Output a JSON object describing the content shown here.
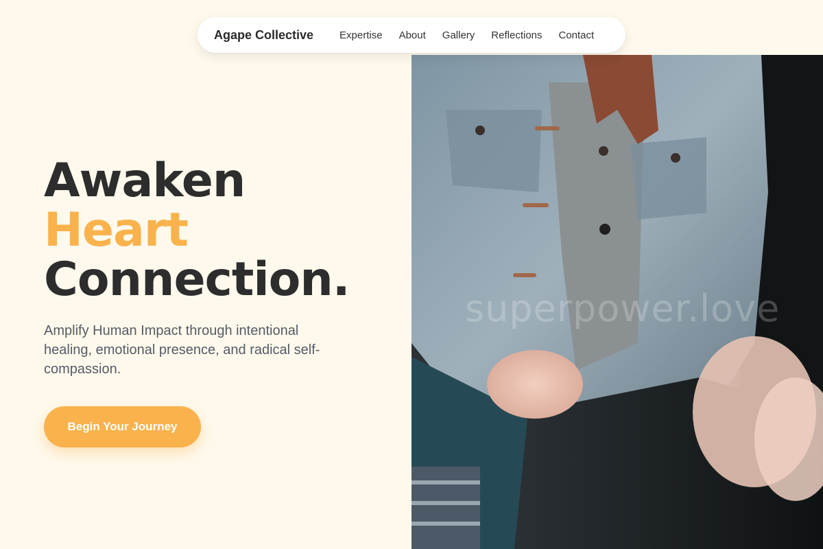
{
  "nav": {
    "brand": "Agape Collective",
    "links": [
      "Expertise",
      "About",
      "Gallery",
      "Reflections",
      "Contact"
    ]
  },
  "hero": {
    "headline_line1": "Awaken",
    "headline_accent": "Heart",
    "headline_line3": "Connection.",
    "subtitle": "Amplify Human Impact through intentional healing, emotional presence, and radical self-compassion.",
    "cta_label": "Begin Your Journey",
    "image_watermark": "superpower.love"
  },
  "colors": {
    "background": "#fef9ec",
    "accent": "#f9b24c",
    "heading": "#2d2d2d",
    "body_text": "#555b66"
  }
}
